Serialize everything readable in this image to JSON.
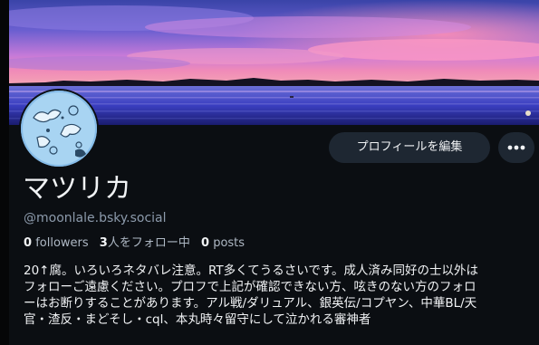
{
  "profile": {
    "display_name": "マツリカ",
    "handle": "@moonlale.bsky.social",
    "buttons": {
      "edit_label": "プロフィールを編集",
      "more_icon": "ellipsis-horizontal-icon"
    },
    "stats": [
      {
        "count": "0",
        "label": "followers"
      },
      {
        "count": "3",
        "label": "人をフォロー中"
      },
      {
        "count": "0",
        "label": "posts"
      }
    ],
    "bio_lines": [
      "20↑腐。いろいろネタバレ注意。RT多くてうるさいです。成人済み同好の士以外は",
      "フォローご遠慮ください。プロフで上記が確認できない方、呟きのない方のフォロ",
      "ーはお断りすることがあります。アル戦/ダリュアル、銀英伝/コプヤン、中華BL/天",
      "官・渣反・まどそし・cql、本丸時々留守にして泣かれる審神者"
    ],
    "banner": {
      "description_icon": "sunset-lake-banner"
    },
    "avatar": {
      "icon": "moon-avatar"
    }
  },
  "colors": {
    "background": "#0b0e12",
    "button_bg": "#1e2732",
    "text_primary": "#f1f3f5",
    "text_secondary": "#8c9aab"
  }
}
